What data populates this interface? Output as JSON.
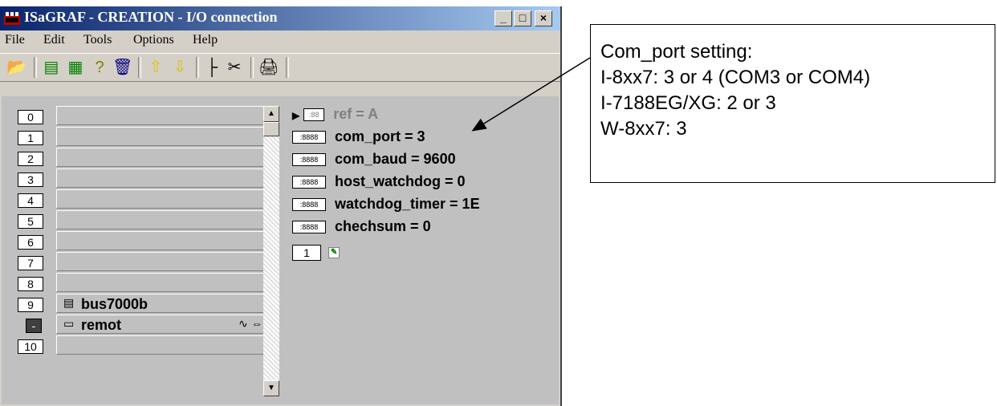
{
  "window": {
    "title": "ISaGRAF - CREATION - I/O connection",
    "buttons": [
      "_",
      "□",
      "×"
    ]
  },
  "menu": [
    {
      "label": "File"
    },
    {
      "label": "Edit"
    },
    {
      "label": "Tools"
    },
    {
      "label": "Options"
    },
    {
      "label": "Help"
    }
  ],
  "toolbar": {
    "icons": [
      "open-icon",
      "board-icon",
      "copy-icon",
      "help-icon",
      "trash-icon",
      "arrow-up-icon",
      "arrow-down-icon",
      "tree-icon",
      "cut-icon",
      "print-icon"
    ]
  },
  "slots": [
    {
      "num": "0",
      "label": ""
    },
    {
      "num": "1",
      "label": ""
    },
    {
      "num": "2",
      "label": ""
    },
    {
      "num": "3",
      "label": ""
    },
    {
      "num": "4",
      "label": ""
    },
    {
      "num": "5",
      "label": ""
    },
    {
      "num": "6",
      "label": ""
    },
    {
      "num": "7",
      "label": ""
    },
    {
      "num": "8",
      "label": ""
    },
    {
      "num": "9",
      "label": "bus7000b"
    },
    {
      "num": "-",
      "label": "remot"
    },
    {
      "num": "10",
      "label": ""
    }
  ],
  "params": {
    "ref": "ref = A",
    "com_port": "com_port = 3",
    "com_baud": "com_baud = 9600",
    "host_watchdog": "host_watchdog = 0",
    "watchdog_timer": "watchdog_timer = 1E",
    "checksum": "chechsum = 0",
    "channel": "1"
  },
  "note": {
    "line1": "Com_port setting:",
    "line2": "I-8xx7: 3 or 4 (COM3 or COM4)",
    "line3": "I-7188EG/XG: 2 or 3",
    "line4": "W-8xx7: 3"
  }
}
